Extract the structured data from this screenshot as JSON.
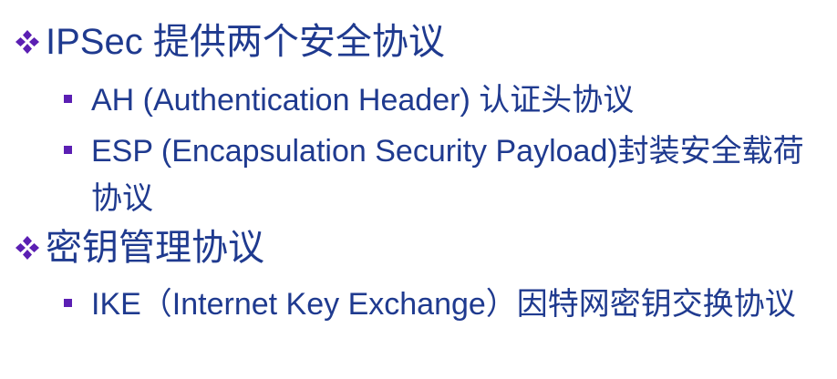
{
  "bullets": [
    {
      "heading": "IPSec 提供两个安全协议",
      "items": [
        "AH (Authentication Header) 认证头协议",
        "ESP (Encapsulation Security Payload)封装安全载荷协议"
      ]
    },
    {
      "heading": "密钥管理协议",
      "items": [
        "IKE（Internet Key Exchange）因特网密钥交换协议"
      ]
    }
  ],
  "colors": {
    "text": "#1f3a8f",
    "marker": "#5b1fb3"
  },
  "icons": {
    "level1_marker": "four-diamond-icon",
    "level2_marker": "square-bullet-icon"
  }
}
